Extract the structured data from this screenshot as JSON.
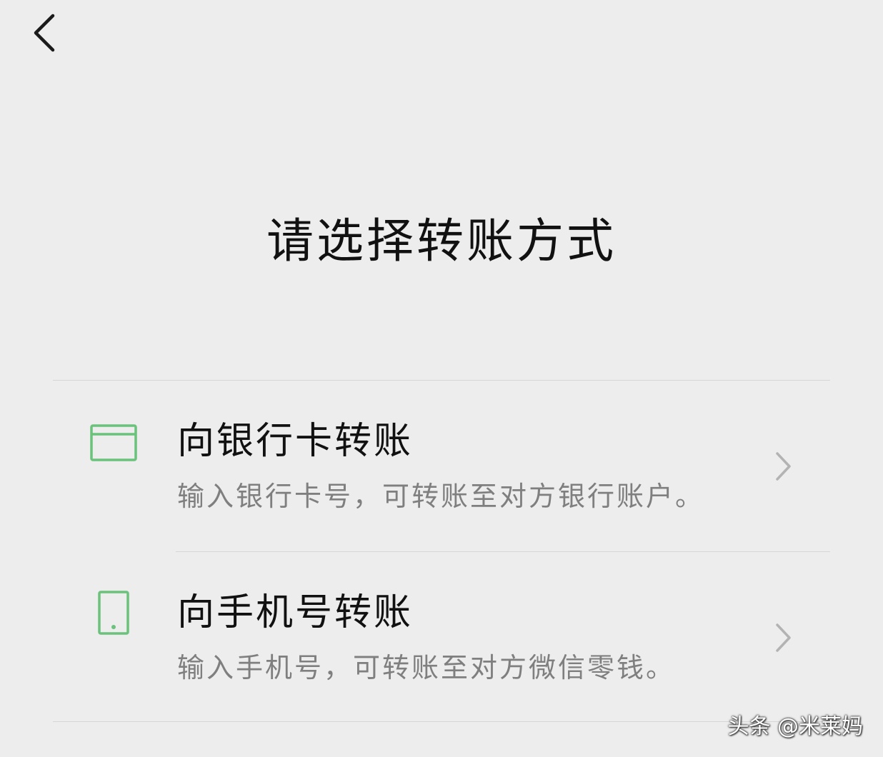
{
  "page": {
    "title": "请选择转账方式",
    "back_icon": "chevron-left-icon"
  },
  "options": [
    {
      "title": "向银行卡转账",
      "description": "输入银行卡号，可转账至对方银行账户。",
      "icon": "bank-card-icon",
      "icon_color": "#6ac27b"
    },
    {
      "title": "向手机号转账",
      "description": "输入手机号，可转账至对方微信零钱。",
      "icon": "phone-icon",
      "icon_color": "#6ac27b"
    }
  ],
  "watermark": {
    "text": "头条 @米莱妈"
  },
  "colors": {
    "background": "#ededed",
    "accent": "#6ac27b",
    "divider": "#d6d6d6",
    "secondary_text": "#7f7f7f",
    "chevron": "#b3b3b3"
  }
}
